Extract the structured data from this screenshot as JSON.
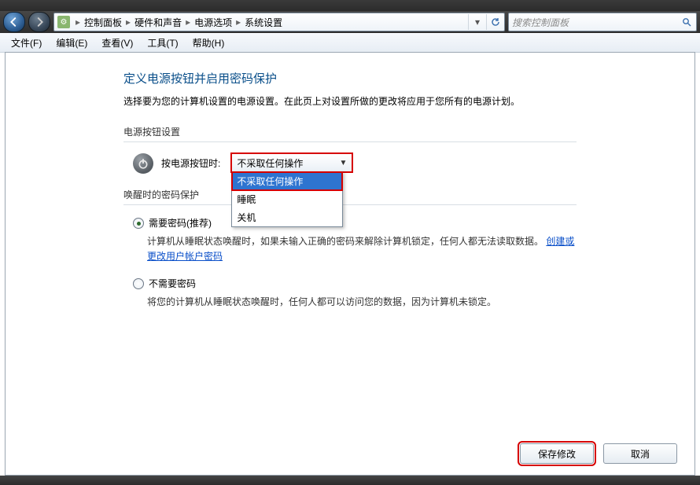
{
  "breadcrumbs": [
    "控制面板",
    "硬件和声音",
    "电源选项",
    "系统设置"
  ],
  "search": {
    "placeholder": "搜索控制面板"
  },
  "menu": {
    "file": "文件(F)",
    "edit": "编辑(E)",
    "view": "查看(V)",
    "tools": "工具(T)",
    "help": "帮助(H)"
  },
  "page": {
    "title": "定义电源按钮并启用密码保护",
    "desc": "选择要为您的计算机设置的电源设置。在此页上对设置所做的更改将应用于您所有的电源计划。",
    "section_power": "电源按钮设置",
    "power_label": "按电源按钮时:",
    "dropdown": {
      "selected": "不采取任何操作",
      "options": [
        "不采取任何操作",
        "睡眠",
        "关机"
      ]
    },
    "section_wake": "唤醒时的密码保护",
    "opt_req": {
      "label": "需要密码(推荐)",
      "desc_a": "计算机从睡眠状态唤醒时，如果未输入正确的密码来解除计算机锁定，任何人都无法读取数据。",
      "link": "创建或更改用户帐户密码"
    },
    "opt_noreq": {
      "label": "不需要密码",
      "desc": "将您的计算机从睡眠状态唤醒时，任何人都可以访问您的数据，因为计算机未锁定。"
    }
  },
  "buttons": {
    "save": "保存修改",
    "cancel": "取消"
  }
}
